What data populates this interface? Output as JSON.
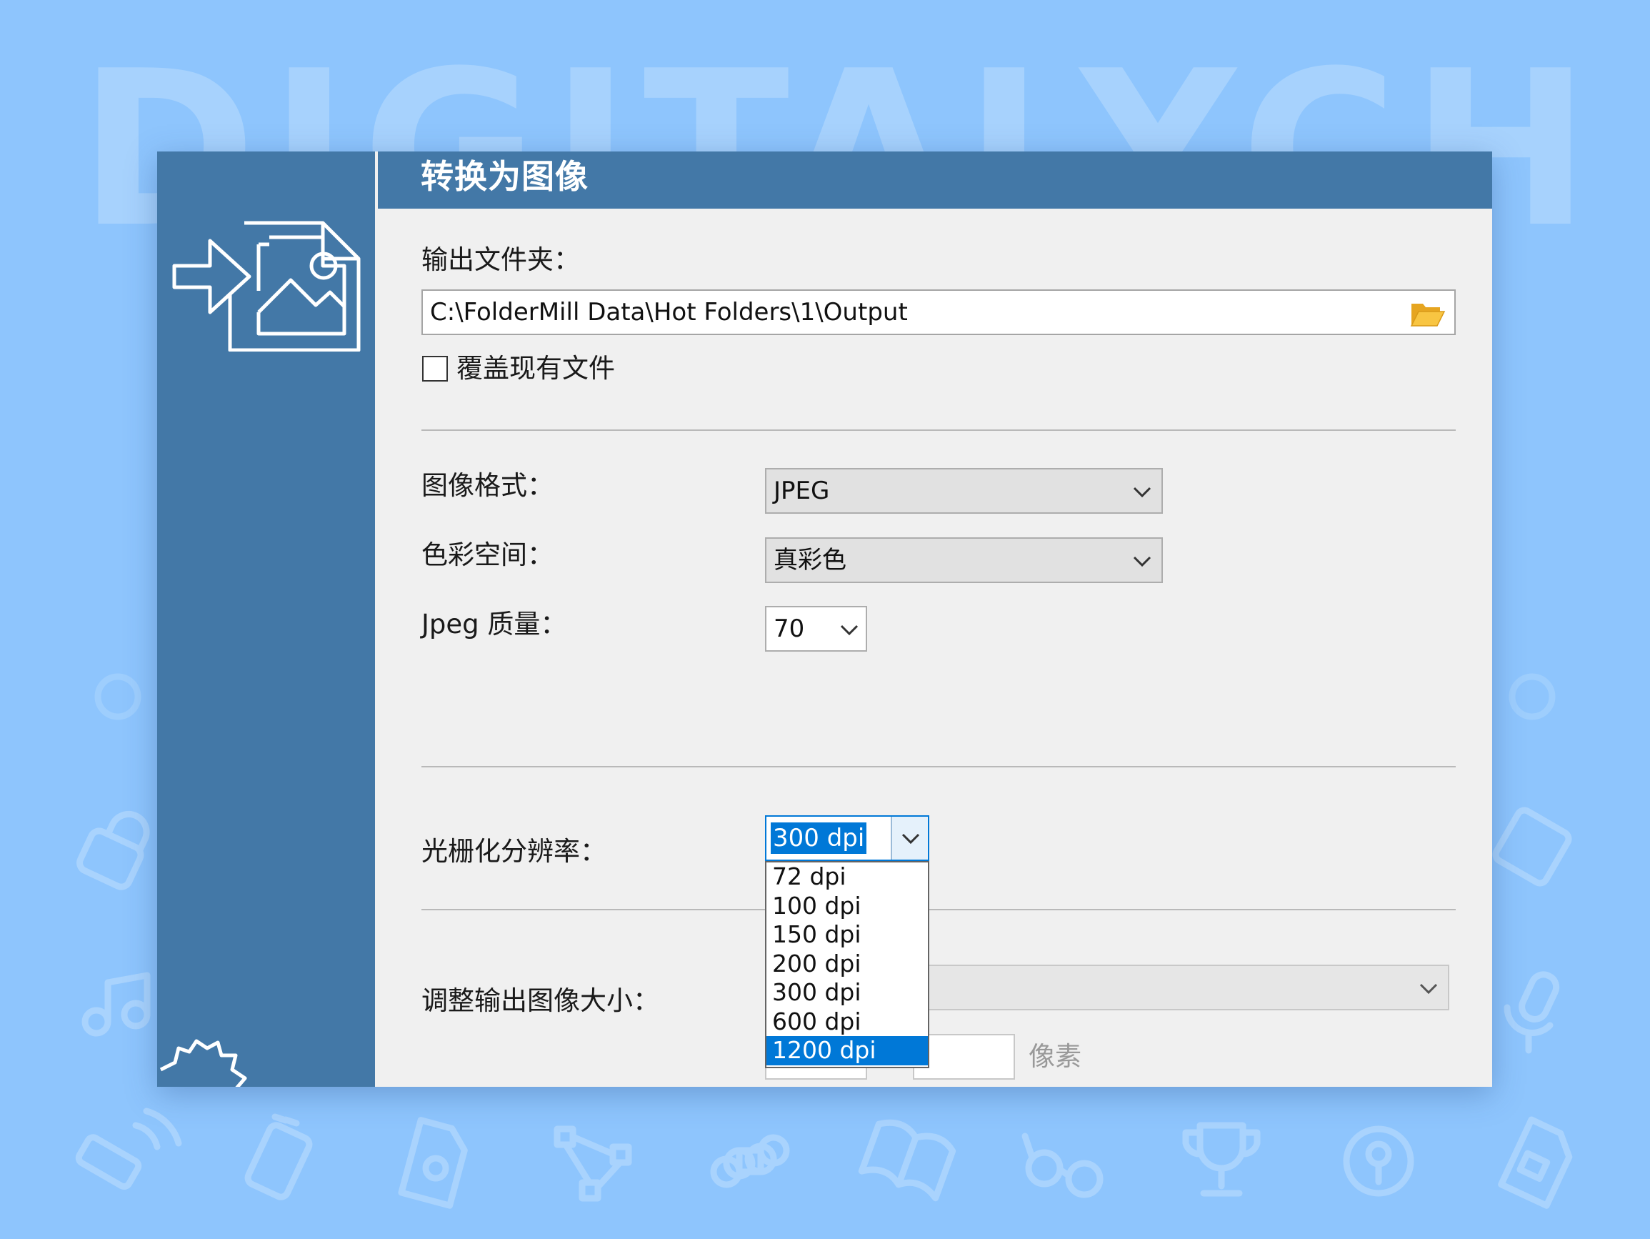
{
  "background": {
    "color": "#8ec5fd",
    "watermark": "DIGITALYCHEF",
    "icons": [
      "lock-icon",
      "music-note-icon",
      "wifi-hand-icon",
      "usb-drive-icon",
      "file-lock-icon",
      "vector-nodes-icon",
      "command-key-icon",
      "book-icon",
      "glasses-icon",
      "trophy-icon",
      "key-circle-icon",
      "sd-card-icon",
      "microphone-icon",
      "database-icon"
    ]
  },
  "sidebar": {
    "color": "#4378a7",
    "icons": [
      "convert-to-image-icon",
      "gear-icon"
    ]
  },
  "header": {
    "title": "转换为图像",
    "color": "#4378a7"
  },
  "output": {
    "label": "输出文件夹：",
    "path": "C:\\FolderMill Data\\Hot Folders\\1\\Output",
    "folder_icon": "open-folder-icon",
    "overwrite_label": "覆盖现有文件",
    "overwrite_checked": false
  },
  "format": {
    "image_format_label": "图像格式：",
    "image_format_value": "JPEG",
    "color_space_label": "色彩空间：",
    "color_space_value": "真彩色",
    "jpeg_quality_label": "Jpeg 质量：",
    "jpeg_quality_value": "70"
  },
  "raster": {
    "label": "光栅化分辨率：",
    "selected": "300 dpi",
    "options": [
      "72 dpi",
      "100 dpi",
      "150 dpi",
      "200 dpi",
      "300 dpi",
      "600 dpi",
      "1200 dpi"
    ],
    "highlighted_option": "1200 dpi",
    "accent": "#0078d7"
  },
  "resize": {
    "label": "调整输出图像大小：",
    "unit": "像素"
  }
}
